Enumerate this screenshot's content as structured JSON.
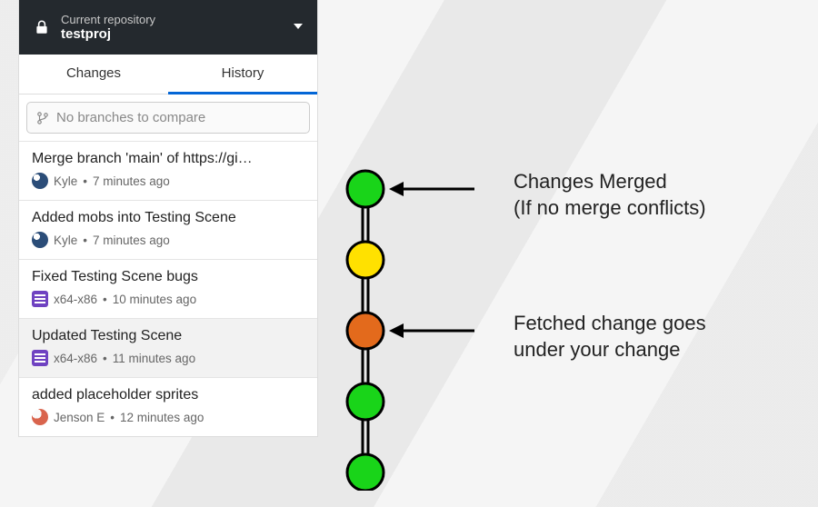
{
  "repo": {
    "label": "Current repository",
    "name": "testproj"
  },
  "tabs": {
    "changes": "Changes",
    "history": "History"
  },
  "branch_compare": {
    "placeholder": "No branches to compare"
  },
  "commits": [
    {
      "title": "Merge branch 'main' of https://gi…",
      "author": "Kyle",
      "time": "7 minutes ago",
      "avatar": "kyle",
      "selected": false
    },
    {
      "title": "Added mobs into Testing Scene",
      "author": "Kyle",
      "time": "7 minutes ago",
      "avatar": "kyle",
      "selected": false
    },
    {
      "title": "Fixed Testing Scene bugs",
      "author": "x64-x86",
      "time": "10 minutes ago",
      "avatar": "x64",
      "selected": false
    },
    {
      "title": "Updated Testing Scene",
      "author": "x64-x86",
      "time": "11 minutes ago",
      "avatar": "x64",
      "selected": true
    },
    {
      "title": "added placeholder sprites",
      "author": "Jenson E",
      "time": "12 minutes ago",
      "avatar": "jenson",
      "selected": false
    }
  ],
  "diagram": {
    "nodes": [
      {
        "color": "#19d419"
      },
      {
        "color": "#ffe100"
      },
      {
        "color": "#e36a1c"
      },
      {
        "color": "#19d419"
      },
      {
        "color": "#19d419"
      }
    ]
  },
  "annotations": {
    "top_line1": "Changes Merged",
    "top_line2": "(If no merge conflicts)",
    "mid_line1": "Fetched change goes",
    "mid_line2": "under your change"
  }
}
